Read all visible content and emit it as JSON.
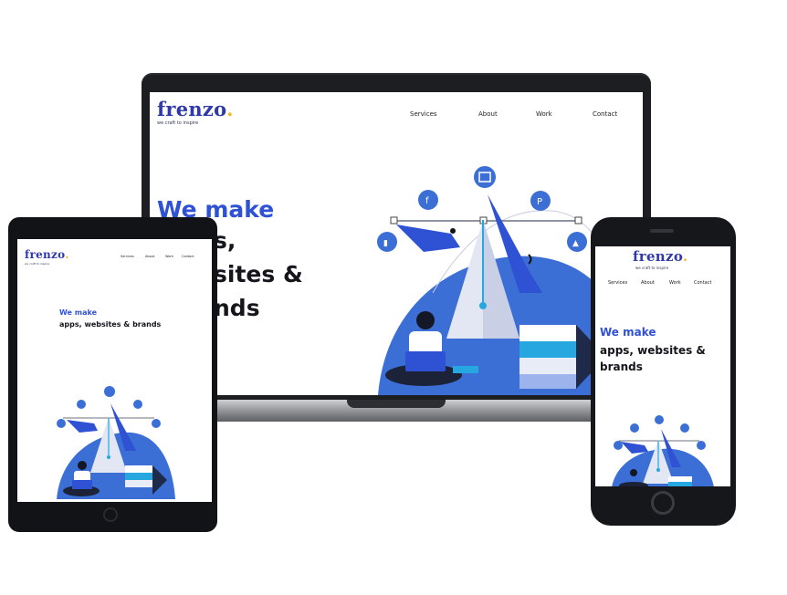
{
  "site": {
    "logo": "frenzo",
    "logo_dot": ".",
    "tagline": "we craft to inspire",
    "nav": [
      "Services",
      "About",
      "Work",
      "Contact"
    ],
    "hero_line1": "We make",
    "hero_line2": "apps, websites &",
    "hero_line3": "brands",
    "laptop_line2_visible": "s,",
    "laptop_line3_visible": "sites &",
    "laptop_line4_visible": "nds"
  },
  "colors": {
    "accent_blue": "#2f52d4",
    "brand_navy": "#2f3aa8",
    "logo_dot_yellow": "#f5b820",
    "illustration_blue": "#3b6fd6",
    "illustration_cyan": "#27a7e0"
  },
  "icons": {
    "hero_orbit_icons": [
      "mobile-icon",
      "facebook-icon",
      "chart-icon",
      "patreon-icon",
      "rocket-icon"
    ]
  }
}
